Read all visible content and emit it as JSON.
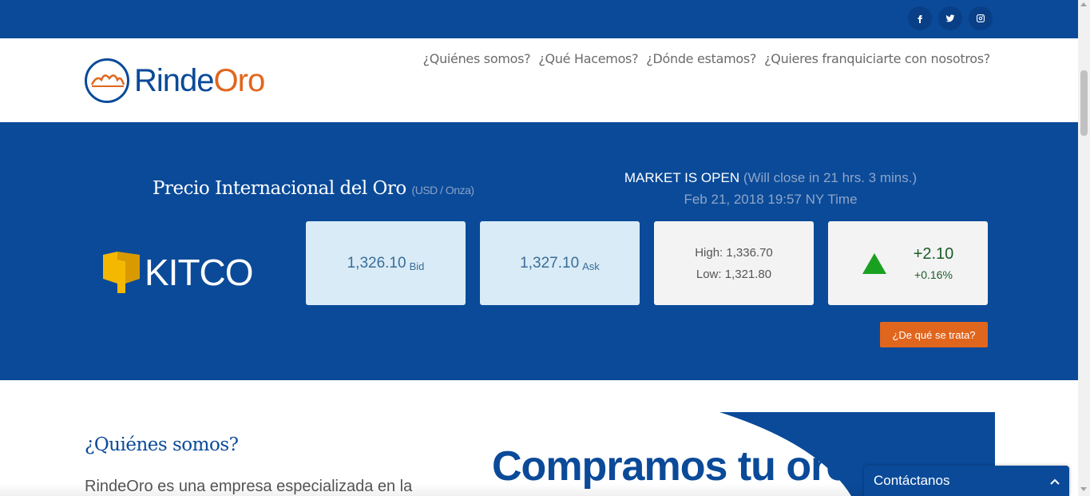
{
  "colors": {
    "brand_blue": "#0a4a99",
    "brand_orange": "#e0661d",
    "up_green": "#1aa020"
  },
  "social": [
    {
      "name": "facebook-icon",
      "glyph": "f"
    },
    {
      "name": "twitter-icon",
      "glyph": "twitter"
    },
    {
      "name": "instagram-icon",
      "glyph": "instagram"
    }
  ],
  "logo": {
    "part1": "Rinde",
    "part2": "Oro"
  },
  "nav": {
    "items": [
      {
        "label": "¿Quiénes somos?"
      },
      {
        "label": "¿Qué Hacemos?"
      },
      {
        "label": "¿Dónde estamos?"
      },
      {
        "label": "¿Quieres franquiciarte con nosotros?"
      }
    ]
  },
  "gold": {
    "title": "Precio Internacional del Oro",
    "unit": "(USD / Onza)",
    "market_status": "MARKET IS OPEN",
    "market_close": "(Will close in 21 hrs. 3 mins.)",
    "timestamp": "Feb 21, 2018 19:57 NY Time",
    "source": "KITCO",
    "bid": {
      "value": "1,326.10",
      "label": "Bid"
    },
    "ask": {
      "value": "1,327.10",
      "label": "Ask"
    },
    "high": "High: 1,336.70",
    "low": "Low: 1,321.80",
    "change": "+2.10",
    "change_pct": "+0.16%",
    "trend": "up",
    "about_button": "¿De qué se trata?"
  },
  "who": {
    "title": "¿Quiénes somos?",
    "text": "RindeOro es una empresa especializada en la"
  },
  "banner": {
    "text": "Compramos tu oro,"
  },
  "chat": {
    "label": "Contáctanos",
    "icon": "chevron-up-icon"
  }
}
